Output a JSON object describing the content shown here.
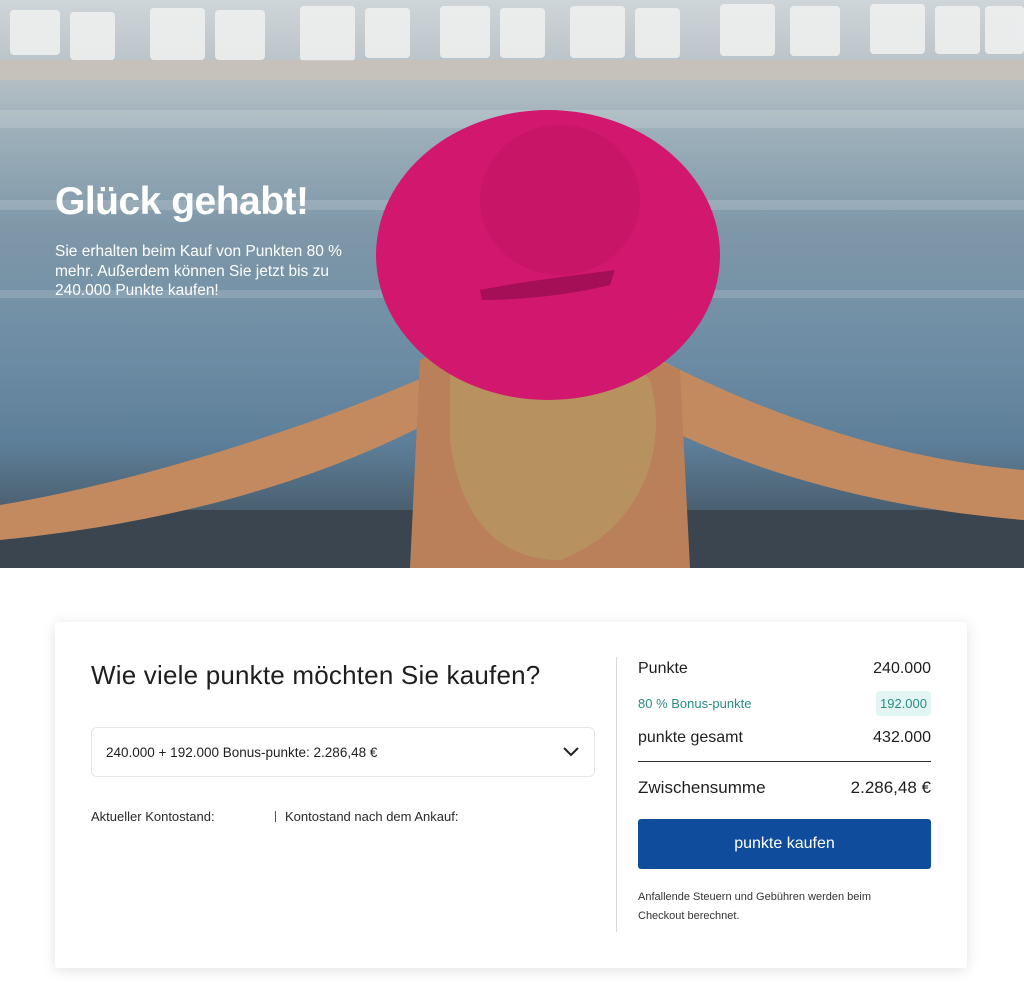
{
  "hero": {
    "title": "Glück gehabt!",
    "subtitle": "Sie erhalten beim Kauf von Punkten 80 % mehr. Außerdem können Sie jetzt bis zu 240.000 Punkte kaufen!"
  },
  "purchase": {
    "question": "Wie viele punkte möchten Sie kaufen?",
    "selected_option": "240.000 + 192.000 Bonus-punkte: 2.286,48 €",
    "current_balance_label": "Aktueller Kontostand:",
    "after_balance_label": "Kontostand nach dem Ankauf:"
  },
  "summary": {
    "points_label": "Punkte",
    "points_value": "240.000",
    "bonus_label": "80 % Bonus-punkte",
    "bonus_value": "192.000",
    "total_label": "punkte gesamt",
    "total_value": "432.000",
    "subtotal_label": "Zwischensumme",
    "subtotal_value": "2.286,48 €",
    "buy_button": "punkte kaufen",
    "note": "Anfallende Steuern und Gebühren werden beim Checkout berechnet."
  },
  "colors": {
    "primary_button": "#0f4c9c",
    "bonus_accent": "#2b8c82",
    "bonus_badge_bg": "#e3f5f2",
    "hat": "#d2176f"
  }
}
